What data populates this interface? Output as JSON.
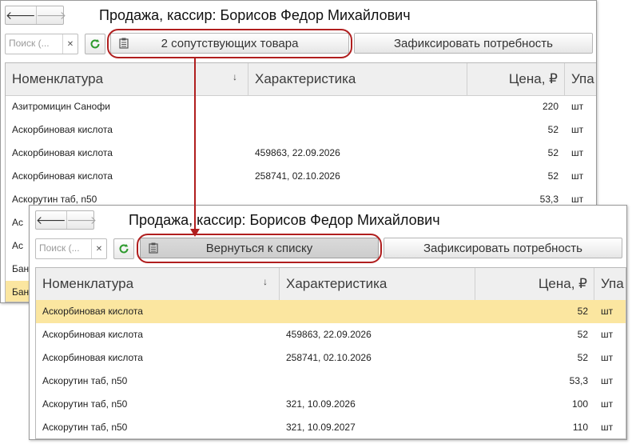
{
  "colors": {
    "highlight_ring": "#b01e1e",
    "selected_row": "#fbe6a0"
  },
  "icons": {
    "back": "left-arrow-icon",
    "forward": "right-arrow-icon",
    "refresh": "refresh-icon",
    "clear": "close-icon",
    "list": "clipboard-icon"
  },
  "back_window": {
    "nav": {
      "back": "🡐",
      "forward": "🡒"
    },
    "title": "Продажа, кассир: Борисов Федор Михайлович",
    "search": {
      "placeholder": "Поиск (...",
      "clear": "✕"
    },
    "toolbar": {
      "related_label": "2 сопутствующих товара",
      "fix_label": "Зафиксировать потребность"
    },
    "columns": {
      "name": "Номенклатура",
      "sort": "↓",
      "characteristic": "Характеристика",
      "price": "Цена, ₽",
      "unit": "Упа"
    },
    "rows": [
      {
        "name": "Азитромицин Санофи",
        "characteristic": "",
        "price": "220",
        "unit": "шт"
      },
      {
        "name": "Аскорбиновая кислота",
        "characteristic": "",
        "price": "52",
        "unit": "шт"
      },
      {
        "name": "Аскорбиновая кислота",
        "characteristic": "459863, 22.09.2026",
        "price": "52",
        "unit": "шт"
      },
      {
        "name": "Аскорбиновая кислота",
        "characteristic": "258741, 02.10.2026",
        "price": "52",
        "unit": "шт"
      },
      {
        "name": "Аскорутин таб, n50",
        "characteristic": "",
        "price": "53,3",
        "unit": "шт"
      }
    ],
    "partial_rows": [
      "Ас",
      "Ас",
      "Бан",
      "Бан"
    ]
  },
  "front_window": {
    "nav": {
      "back": "🡐",
      "forward": "🡒"
    },
    "title": "Продажа, кассир: Борисов Федор Михайлович",
    "search": {
      "placeholder": "Поиск (...",
      "clear": "✕"
    },
    "toolbar": {
      "return_label": "Вернуться к списку",
      "fix_label": "Зафиксировать потребность"
    },
    "columns": {
      "name": "Номенклатура",
      "sort": "↓",
      "characteristic": "Характеристика",
      "price": "Цена, ₽",
      "unit": "Упа"
    },
    "rows": [
      {
        "name": "Аскорбиновая кислота",
        "characteristic": "",
        "price": "52",
        "unit": "шт",
        "selected": true
      },
      {
        "name": "Аскорбиновая кислота",
        "characteristic": "459863, 22.09.2026",
        "price": "52",
        "unit": "шт"
      },
      {
        "name": "Аскорбиновая кислота",
        "characteristic": "258741, 02.10.2026",
        "price": "52",
        "unit": "шт"
      },
      {
        "name": "Аскорутин таб, n50",
        "characteristic": "",
        "price": "53,3",
        "unit": "шт"
      },
      {
        "name": "Аскорутин таб, n50",
        "characteristic": "321, 10.09.2026",
        "price": "100",
        "unit": "шт"
      },
      {
        "name": "Аскорутин таб, n50",
        "characteristic": "321, 10.09.2027",
        "price": "110",
        "unit": "шт"
      }
    ]
  }
}
